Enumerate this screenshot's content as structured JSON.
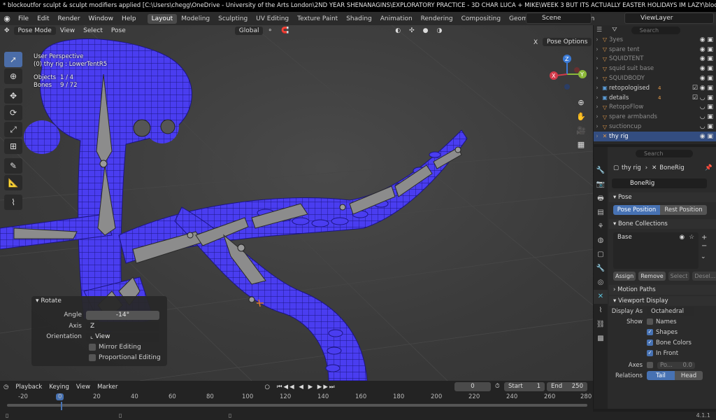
{
  "window_title": "* blockoutfor sculpt & sculpt modifiers applied [C:\\Users\\chegg\\OneDrive - University of the Arts London\\2ND YEAR SHENANAGINS\\EXPLORATORY PRACTICE - 3D CHAR LUCA + MIKE\\WEEK 3 BUT ITS ACTUALLY EASTER HOLIDAYS IM LAZY\\block...",
  "menu": [
    "File",
    "Edit",
    "Render",
    "Window",
    "Help"
  ],
  "workspaces": [
    "Layout",
    "Modeling",
    "Sculpting",
    "UV Editing",
    "Texture Paint",
    "Shading",
    "Animation",
    "Rendering",
    "Compositing",
    "Geometry Nodes",
    "Scriptin"
  ],
  "active_workspace": "Layout",
  "scene": "Scene",
  "view_layer": "ViewLayer",
  "viewport": {
    "mode": "Pose Mode",
    "menus": [
      "View",
      "Select",
      "Pose"
    ],
    "orientation": "Global",
    "pose_options": "Pose Options",
    "x_mirror": "X",
    "hud_lines": [
      "User Perspective",
      "(0) thy rig : LowerTentR5"
    ],
    "stats": [
      {
        "label": "Objects",
        "value": "1 / 4"
      },
      {
        "label": "Bones",
        "value": "9 / 72"
      }
    ],
    "gizmo": {
      "x": "X",
      "y": "Y",
      "z": "Z"
    }
  },
  "rotate_panel": {
    "title": "Rotate",
    "angle_label": "Angle",
    "angle_value": "-14°",
    "axis_label": "Axis",
    "axis_value": "Z",
    "orientation_label": "Orientation",
    "orientation_value": "View",
    "mirror_editing": "Mirror Editing",
    "proportional_editing": "Proportional Editing"
  },
  "outliner": {
    "search_placeholder": "Search",
    "rows": [
      {
        "name": "3yes",
        "dim": true
      },
      {
        "name": "spare tent",
        "dim": true
      },
      {
        "name": "SQUIDTENT",
        "dim": true
      },
      {
        "name": "squid suit base",
        "dim": true
      },
      {
        "name": "SQUIDBODY",
        "dim": true
      },
      {
        "name": "retopologised",
        "dim": false,
        "badge": "4"
      },
      {
        "name": "details",
        "dim": false,
        "badge": "4"
      },
      {
        "name": "RetopoFlow",
        "dim": true
      },
      {
        "name": "spare armbands",
        "dim": true
      },
      {
        "name": "suctioncup",
        "dim": true
      },
      {
        "name": "thy rig",
        "dim": false,
        "selected": true
      }
    ]
  },
  "properties": {
    "search_placeholder": "Search",
    "breadcrumb_object": "thy rig",
    "breadcrumb_data": "BoneRig",
    "armature_name": "BoneRig",
    "pose_section": "Pose",
    "pose_position": "Pose Position",
    "rest_position": "Rest Position",
    "bone_collections_section": "Bone Collections",
    "collection_name": "Base",
    "assign": "Assign",
    "remove": "Remove",
    "select": "Select",
    "deselect": "Desel...",
    "motion_paths_section": "Motion Paths",
    "viewport_display_section": "Viewport Display",
    "display_as_label": "Display As",
    "display_as_value": "Octahedral",
    "show_label": "Show",
    "names": "Names",
    "shapes": "Shapes",
    "bone_colors": "Bone Colors",
    "in_front": "In Front",
    "axes_label": "Axes",
    "axes_pos": "Po...",
    "axes_value": "0.0",
    "relations_label": "Relations",
    "tail": "Tail",
    "head": "Head"
  },
  "timeline": {
    "menus": [
      "Playback",
      "Keying",
      "View",
      "Marker"
    ],
    "current_frame": "0",
    "start_label": "Start",
    "start": "1",
    "end_label": "End",
    "end": "250",
    "ruler": [
      "-20",
      "0",
      "20",
      "40",
      "60",
      "80",
      "100",
      "120",
      "140",
      "160",
      "180",
      "200",
      "220",
      "240",
      "260",
      "280"
    ]
  },
  "status": {
    "version": "4.1.1"
  }
}
